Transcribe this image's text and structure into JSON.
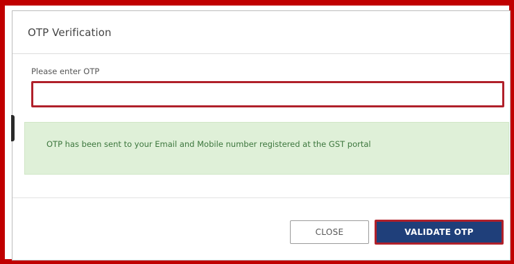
{
  "modal": {
    "title": "OTP Verification",
    "otp_label": "Please enter OTP",
    "otp_value": "",
    "alert_text": "OTP has been sent to your Email and Mobile number registered at the GST portal",
    "close_label": "CLOSE",
    "validate_label": "VALIDATE OTP"
  },
  "colors": {
    "highlight_border": "#b0202a",
    "primary_button": "#1f3f7a",
    "alert_bg": "#dff0d8",
    "alert_text": "#3c763d"
  }
}
